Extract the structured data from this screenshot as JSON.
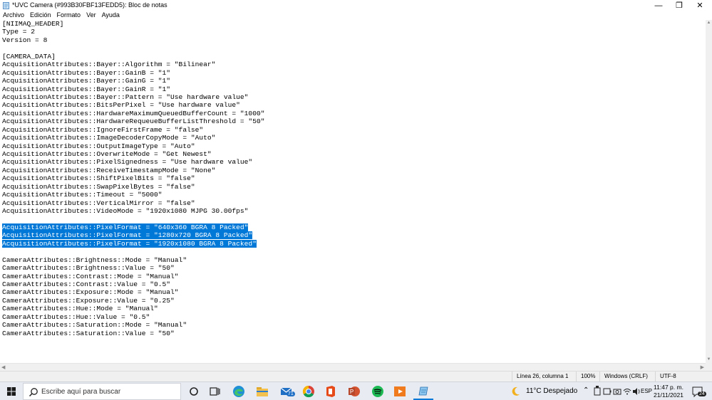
{
  "window": {
    "title": "*UVC Camera  (#993B30FBF13FEDD5): Bloc de notas",
    "min_symbol": "—",
    "max_symbol": "❐",
    "close_symbol": "✕"
  },
  "menu": [
    "Archivo",
    "Edición",
    "Formato",
    "Ver",
    "Ayuda"
  ],
  "editor": {
    "lines": [
      "[NIIMAQ_HEADER]",
      "Type = 2",
      "Version = 8",
      "",
      "[CAMERA_DATA]",
      "AcquisitionAttributes::Bayer::Algorithm = \"Bilinear\"",
      "AcquisitionAttributes::Bayer::GainB = \"1\"",
      "AcquisitionAttributes::Bayer::GainG = \"1\"",
      "AcquisitionAttributes::Bayer::GainR = \"1\"",
      "AcquisitionAttributes::Bayer::Pattern = \"Use hardware value\"",
      "AcquisitionAttributes::BitsPerPixel = \"Use hardware value\"",
      "AcquisitionAttributes::HardwareMaximumQueuedBufferCount = \"1000\"",
      "AcquisitionAttributes::HardwareRequeueBufferListThreshold = \"50\"",
      "AcquisitionAttributes::IgnoreFirstFrame = \"false\"",
      "AcquisitionAttributes::ImageDecoderCopyMode = \"Auto\"",
      "AcquisitionAttributes::OutputImageType = \"Auto\"",
      "AcquisitionAttributes::OverwriteMode = \"Get Newest\"",
      "AcquisitionAttributes::PixelSignedness = \"Use hardware value\"",
      "AcquisitionAttributes::ReceiveTimestampMode = \"None\"",
      "AcquisitionAttributes::ShiftPixelBits = \"false\"",
      "AcquisitionAttributes::SwapPixelBytes = \"false\"",
      "AcquisitionAttributes::Timeout = \"5000\"",
      "AcquisitionAttributes::VerticalMirror = \"false\"",
      "AcquisitionAttributes::VideoMode = \"1920x1080 MJPG 30.00fps\"",
      "",
      "AcquisitionAttributes::PixelFormat = \"640x360 BGRA 8 Packed\"",
      "AcquisitionAttributes::PixelFormat = \"1280x720 BGRA 8 Packed\"",
      "AcquisitionAttributes::PixelFormat = \"1920x1080 BGRA 8 Packed\"",
      "",
      "CameraAttributes::Brightness::Mode = \"Manual\"",
      "CameraAttributes::Brightness::Value = \"50\"",
      "CameraAttributes::Contrast::Mode = \"Manual\"",
      "CameraAttributes::Contrast::Value = \"0.5\"",
      "CameraAttributes::Exposure::Mode = \"Manual\"",
      "CameraAttributes::Exposure::Value = \"0.25\"",
      "CameraAttributes::Hue::Mode = \"Manual\"",
      "CameraAttributes::Hue::Value = \"0.5\"",
      "CameraAttributes::Saturation::Mode = \"Manual\"",
      "CameraAttributes::Saturation::Value = \"50\""
    ],
    "selected_lines": [
      25,
      26,
      27
    ]
  },
  "statusbar": {
    "position": "Línea 26, columna 1",
    "zoom": "100%",
    "line_endings": "Windows (CRLF)",
    "encoding": "UTF-8"
  },
  "taskbar": {
    "search_placeholder": "Escribe aquí para buscar",
    "mail_badge": "71",
    "weather": "11°C  Despejado",
    "language": "ESP",
    "time": "11:47 p. m.",
    "date": "21/11/2021",
    "notification_count": "24"
  },
  "colors": {
    "selection": "#0078d7",
    "taskbar": "#e8ecf2"
  }
}
